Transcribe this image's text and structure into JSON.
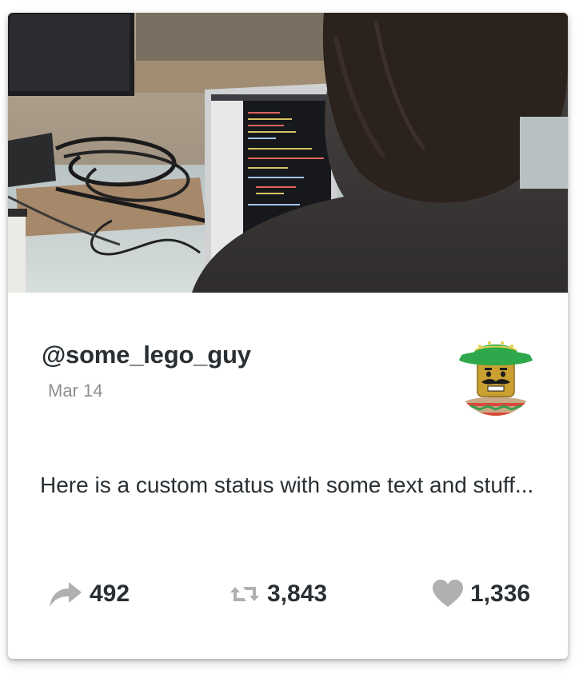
{
  "card": {
    "hero_image": "person coding at laptop photo",
    "handle": "@some_lego_guy",
    "date": "Mar 14",
    "avatar": "lego-minifigure-avatar",
    "status_text": "Here is a custom status with some text and stuff...",
    "actions": {
      "share": {
        "icon": "share-arrow-icon",
        "count": "492"
      },
      "retweet": {
        "icon": "retweet-icon",
        "count": "3,843"
      },
      "like": {
        "icon": "heart-icon",
        "count": "1,336"
      }
    }
  },
  "colors": {
    "text": "#292f33",
    "muted": "#8f8f8f",
    "icon": "#b0b0b0",
    "avatar_hat": "#2ea84a"
  }
}
